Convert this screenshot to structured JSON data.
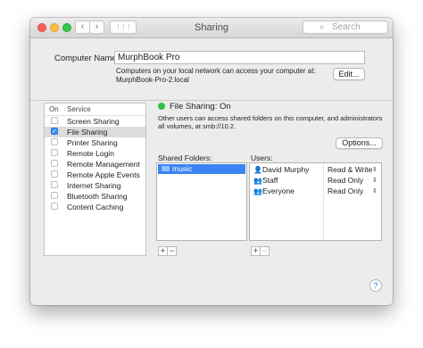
{
  "window": {
    "title": "Sharing"
  },
  "toolbar": {
    "back_glyph": "‹",
    "forward_glyph": "›",
    "grid_glyph": "⋮⋮⋮",
    "search_placeholder": "Search"
  },
  "computer_name": {
    "label": "Computer Name:",
    "value": "MurphBook Pro",
    "note_line1": "Computers on your local network can access your computer at:",
    "note_line2": "MurphBook-Pro-2.local",
    "edit_button": "Edit..."
  },
  "services": {
    "header_on": "On",
    "header_service": "Service",
    "items": [
      {
        "label": "Screen Sharing",
        "checked": false,
        "selected": false
      },
      {
        "label": "File Sharing",
        "checked": true,
        "selected": true
      },
      {
        "label": "Printer Sharing",
        "checked": false,
        "selected": false
      },
      {
        "label": "Remote Login",
        "checked": false,
        "selected": false
      },
      {
        "label": "Remote Management",
        "checked": false,
        "selected": false
      },
      {
        "label": "Remote Apple Events",
        "checked": false,
        "selected": false
      },
      {
        "label": "Internet Sharing",
        "checked": false,
        "selected": false
      },
      {
        "label": "Bluetooth Sharing",
        "checked": false,
        "selected": false
      },
      {
        "label": "Content Caching",
        "checked": false,
        "selected": false
      }
    ]
  },
  "file_sharing": {
    "status": "File Sharing: On",
    "desc_line1": "Other users can access shared folders on this computer, and administrators",
    "desc_line2": "all volumes, at smb://10.2.",
    "options_button": "Options...",
    "shared_folders_label": "Shared Folders:",
    "folders": [
      {
        "name": "music"
      }
    ],
    "users_label": "Users:",
    "users": [
      {
        "name": "David Murphy",
        "permission": "Read & Write",
        "icon": "user-icon"
      },
      {
        "name": "Staff",
        "permission": "Read Only",
        "icon": "group-icon"
      },
      {
        "name": "Everyone",
        "permission": "Read Only",
        "icon": "everyone-icon"
      }
    ],
    "add_glyph": "+",
    "remove_glyph": "−"
  },
  "help_glyph": "?",
  "colors": {
    "accent": "#3b84f3",
    "status_on": "#31c048"
  }
}
